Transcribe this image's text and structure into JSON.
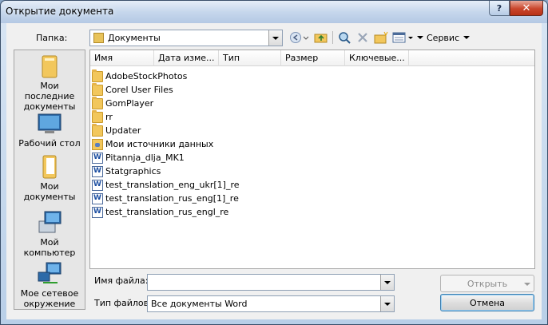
{
  "window": {
    "title": "Открытие документа",
    "help_glyph": "?",
    "close_glyph": "✕"
  },
  "toolbar": {
    "folder_label": "Папка:",
    "folder_value": "Документы",
    "tools_label": "Сервис"
  },
  "places": [
    {
      "label": "Мои последние документы",
      "icon": "recent-documents-icon"
    },
    {
      "label": "Рабочий стол",
      "icon": "desktop-icon"
    },
    {
      "label": "Мои документы",
      "icon": "my-documents-icon"
    },
    {
      "label": "Мой компьютер",
      "icon": "my-computer-icon"
    },
    {
      "label": "Мое сетевое окружение",
      "icon": "network-icon"
    }
  ],
  "columns": [
    "Имя",
    "Дата изме...",
    "Тип",
    "Размер",
    "Ключевые..."
  ],
  "files": [
    {
      "name": "AdobeStockPhotos",
      "kind": "folder"
    },
    {
      "name": "Corel User Files",
      "kind": "folder"
    },
    {
      "name": "GomPlayer",
      "kind": "folder"
    },
    {
      "name": "rr",
      "kind": "folder"
    },
    {
      "name": "Updater",
      "kind": "folder"
    },
    {
      "name": "Мои источники данных",
      "kind": "datasource"
    },
    {
      "name": "Pitannja_dlja_MK1",
      "kind": "doc"
    },
    {
      "name": "Statgraphics",
      "kind": "doc"
    },
    {
      "name": "test_translation_eng_ukr[1]_re",
      "kind": "doc"
    },
    {
      "name": "test_translation_rus_eng[1]_re",
      "kind": "doc"
    },
    {
      "name": "test_translation_rus_engl_re",
      "kind": "doc"
    }
  ],
  "bottom": {
    "filename_label": "Имя файла:",
    "filename_value": "",
    "filetype_label": "Тип файлов:",
    "filetype_value": "Все документы Word",
    "open_button": "Открыть",
    "cancel_button": "Отмена"
  },
  "colors": {
    "title_bar": "#c6d7ec",
    "close_button": "#c9462c",
    "folder": "#f2c75c"
  }
}
